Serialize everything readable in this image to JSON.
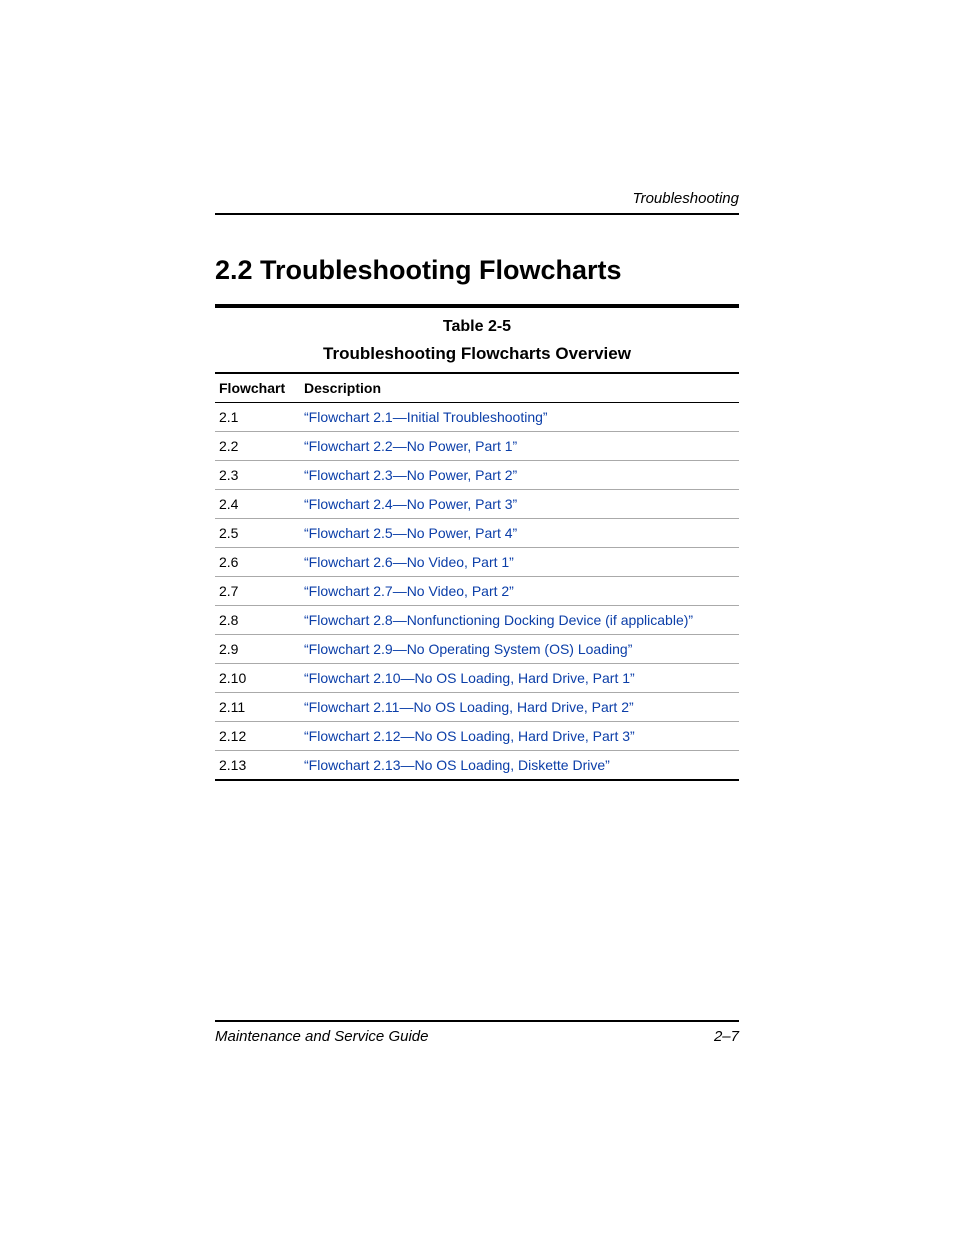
{
  "header": {
    "running_head": "Troubleshooting"
  },
  "heading": "2.2 Troubleshooting Flowcharts",
  "table": {
    "number": "Table 2-5",
    "title": "Troubleshooting Flowcharts Overview",
    "columns": {
      "flowchart": "Flowchart",
      "description": "Description"
    },
    "rows": [
      {
        "flowchart": "2.1",
        "description": "“Flowchart 2.1—Initial Troubleshooting”"
      },
      {
        "flowchart": "2.2",
        "description": "“Flowchart 2.2—No Power, Part 1”"
      },
      {
        "flowchart": "2.3",
        "description": "“Flowchart 2.3—No Power, Part 2”"
      },
      {
        "flowchart": "2.4",
        "description": "“Flowchart 2.4—No Power, Part 3”"
      },
      {
        "flowchart": "2.5",
        "description": "“Flowchart 2.5—No Power, Part 4”"
      },
      {
        "flowchart": "2.6",
        "description": "“Flowchart 2.6—No Video, Part 1”"
      },
      {
        "flowchart": "2.7",
        "description": "“Flowchart 2.7—No Video, Part 2”"
      },
      {
        "flowchart": "2.8",
        "description": "“Flowchart 2.8—Nonfunctioning Docking Device (if applicable)”"
      },
      {
        "flowchart": "2.9",
        "description": "“Flowchart 2.9—No Operating System (OS) Loading”"
      },
      {
        "flowchart": "2.10",
        "description": "“Flowchart 2.10—No OS Loading, Hard Drive, Part 1”"
      },
      {
        "flowchart": "2.11",
        "description": "“Flowchart 2.11—No OS Loading, Hard Drive, Part 2”"
      },
      {
        "flowchart": "2.12",
        "description": "“Flowchart 2.12—No OS Loading, Hard Drive, Part 3”"
      },
      {
        "flowchart": "2.13",
        "description": "“Flowchart 2.13—No OS Loading, Diskette Drive”"
      }
    ]
  },
  "footer": {
    "left": "Maintenance and Service Guide",
    "right": "2–7"
  }
}
